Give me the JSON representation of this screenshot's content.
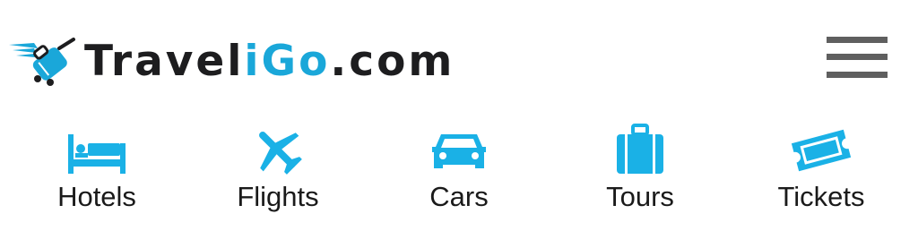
{
  "brand": {
    "name_part1": "Travel",
    "name_accent": "iGo",
    "name_part2": ".com",
    "accent_color": "#1aa7d9",
    "text_color": "#1d1d1f"
  },
  "menu": {
    "icon": "hamburger-menu-icon"
  },
  "nav": {
    "items": [
      {
        "label": "Hotels",
        "icon": "bed-icon"
      },
      {
        "label": "Flights",
        "icon": "airplane-icon"
      },
      {
        "label": "Cars",
        "icon": "car-icon"
      },
      {
        "label": "Tours",
        "icon": "suitcase-icon"
      },
      {
        "label": "Tickets",
        "icon": "ticket-icon"
      }
    ],
    "icon_color": "#1ab1e6"
  }
}
